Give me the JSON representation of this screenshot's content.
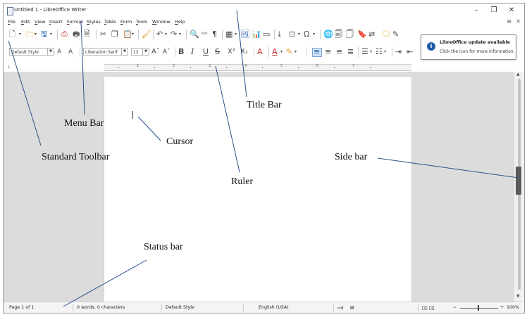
{
  "window": {
    "title": "Untitled 1 - LibreOffice Writer",
    "minimize_glyph": "–",
    "maximize_glyph": "❐",
    "close_glyph": "✕"
  },
  "menu": {
    "items": [
      "File",
      "Edit",
      "View",
      "Insert",
      "Format",
      "Styles",
      "Table",
      "Form",
      "Tools",
      "Window",
      "Help"
    ],
    "right_icon": "globe-icon",
    "close_glyph": "✕"
  },
  "formatting": {
    "paragraph_style": "Default Style",
    "font_name": "Liberation Serif",
    "font_size": "12"
  },
  "notification": {
    "title": "LibreOffice update available",
    "text": "Click the icon for more information.",
    "icon": "info-icon",
    "icon_glyph": "i"
  },
  "ruler": {
    "numbers": [
      "1",
      "2",
      "3",
      "4",
      "5",
      "6",
      "7"
    ]
  },
  "statusbar": {
    "page": "Page 1 of 1",
    "words": "0 words, 0 characters",
    "page_style": "Default Style",
    "language": "English (USA)",
    "zoom": "100%",
    "zoom_minus": "−",
    "zoom_plus": "+"
  },
  "annotations": {
    "title_bar": "Title Bar",
    "menu_bar": "Menu Bar",
    "cursor": "Cursor",
    "standard_toolbar": "Standard Toolbar",
    "side_bar": "Side bar",
    "ruler": "Ruler",
    "status_bar": "Status bar"
  },
  "colors": {
    "accent_blue": "#1e5aa8",
    "workspace_gray": "#dcdcdc",
    "leader_line": "#2b4f8a"
  }
}
